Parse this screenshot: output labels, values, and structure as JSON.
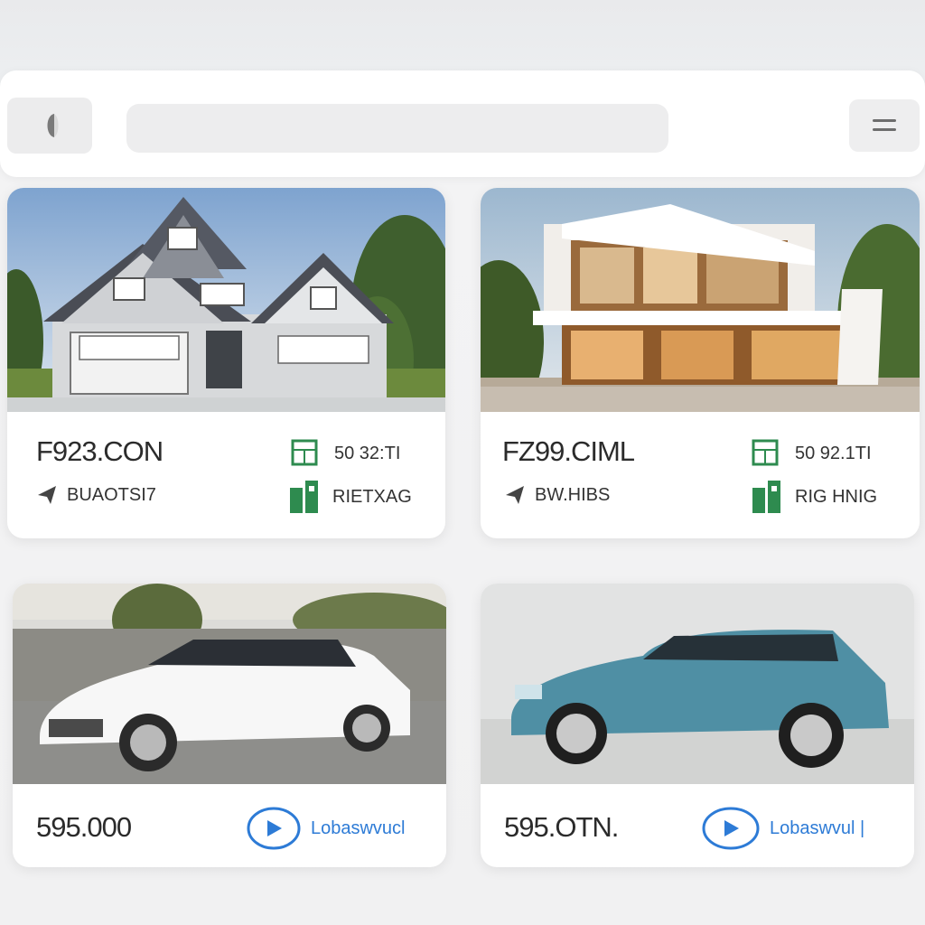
{
  "header": {
    "search_placeholder": "",
    "back_icon": "back-icon",
    "menu_icon": "menu-icon"
  },
  "listings": [
    {
      "type": "house",
      "price": "F923.CON",
      "stat1_value": "50 32:TI",
      "stat2_label": "RIETXAG",
      "location": "BUAOTSI7"
    },
    {
      "type": "house",
      "price": "FZ99.CIML",
      "stat1_value": "50 92.1TI",
      "stat2_label": "RIG HNIG",
      "location": "BW.HIBS"
    },
    {
      "type": "car",
      "price": "595.000",
      "action_label": "Lobaswvucl"
    },
    {
      "type": "car",
      "price": "595.OTN.",
      "action_label": "Lobaswvul |"
    }
  ],
  "colors": {
    "accent_blue": "#2d7bd6",
    "icon_green": "#2e8b4f",
    "card_bg": "#ffffff"
  }
}
